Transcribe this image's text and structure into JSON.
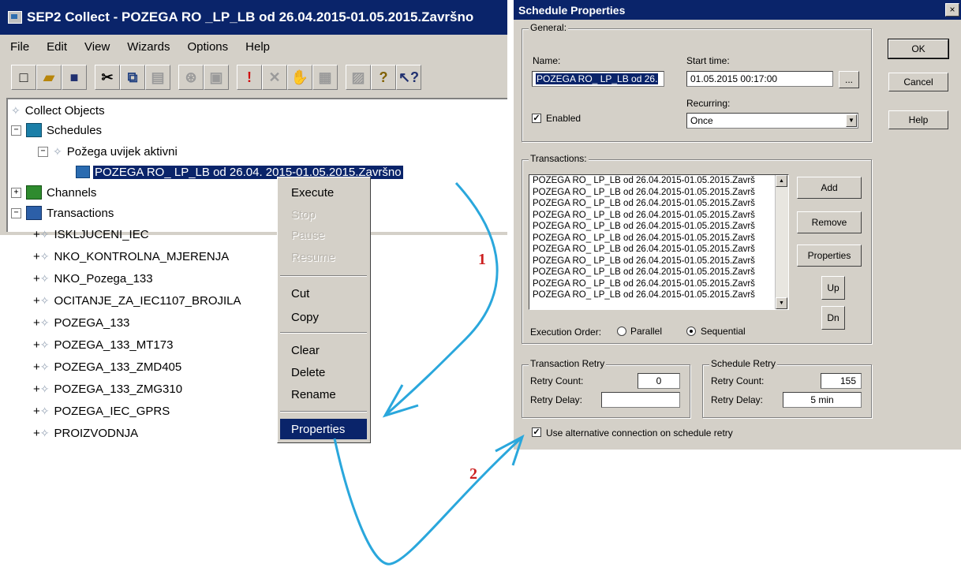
{
  "app": {
    "title": "SEP2 Collect - POZEGA RO _LP_LB od 26.04.2015-01.05.2015.Završno",
    "menu": [
      "File",
      "Edit",
      "View",
      "Wizards",
      "Options",
      "Help"
    ],
    "toolbar_icons": [
      "new-icon",
      "open-icon",
      "save-icon",
      "cut-icon",
      "copy-icon",
      "paste-icon",
      "connect-icon",
      "properties-icon",
      "exclamation-icon",
      "stop-icon",
      "hand-icon",
      "grid-icon",
      "print-icon",
      "help-icon",
      "context-help-icon"
    ],
    "tree": {
      "root": "Collect Objects",
      "schedules": "Schedules",
      "schedule_group": "Požega uvijek aktivni",
      "schedule_item": "POZEGA RO_ LP_LB od 26.04. 2015-01.05.2015.Završno",
      "channels": "Channels",
      "transactions": "Transactions",
      "transaction_items": [
        "ISKLJUCENI_IEC",
        "NKO_KONTROLNA_MJERENJA",
        "NKO_Pozega_133",
        "OCITANJE_ZA_IEC1107_BROJILA",
        "POZEGA_133",
        "POZEGA_133_MT173",
        "POZEGA_133_ZMD405",
        "POZEGA_133_ZMG310",
        "POZEGA_IEC_GPRS",
        "PROIZVODNJA"
      ]
    }
  },
  "context_menu": {
    "items": [
      {
        "label": "Execute",
        "enabled": true
      },
      {
        "label": "Stop",
        "enabled": false
      },
      {
        "label": "Pause",
        "enabled": false
      },
      {
        "label": "Resume",
        "enabled": false
      },
      {
        "label": "Cut",
        "enabled": true
      },
      {
        "label": "Copy",
        "enabled": true
      },
      {
        "label": "Clear",
        "enabled": true
      },
      {
        "label": "Delete",
        "enabled": true
      },
      {
        "label": "Rename",
        "enabled": true
      },
      {
        "label": "Properties",
        "enabled": true,
        "active": true
      }
    ]
  },
  "dialog": {
    "title": "Schedule Properties",
    "close": "×",
    "general": {
      "group_label": "General:",
      "name_label": "Name:",
      "name_value": "POZEGA RO_ LP_LB od 26.",
      "start_label": "Start time:",
      "start_value": "01.05.2015 00:17:00",
      "browse": "...",
      "enabled_label": "Enabled",
      "enabled_checked": true,
      "recurring_label": "Recurring:",
      "recurring_value": "Once"
    },
    "buttons": {
      "ok": "OK",
      "cancel": "Cancel",
      "help": "Help"
    },
    "transactions": {
      "group_label": "Transactions:",
      "rows": [
        "POZEGA RO_ LP_LB od 26.04.2015-01.05.2015.Završ",
        "POZEGA RO_ LP_LB od 26.04.2015-01.05.2015.Završ",
        "POZEGA RO_ LP_LB od 26.04.2015-01.05.2015.Završ",
        "POZEGA RO_ LP_LB od 26.04.2015-01.05.2015.Završ",
        "POZEGA RO_ LP_LB od 26.04.2015-01.05.2015.Završ",
        "POZEGA RO_ LP_LB od 26.04.2015-01.05.2015.Završ",
        "POZEGA RO_ LP_LB od 26.04.2015-01.05.2015.Završ",
        "POZEGA RO_ LP_LB od 26.04.2015-01.05.2015.Završ",
        "POZEGA RO_ LP_LB od 26.04.2015-01.05.2015.Završ",
        "POZEGA RO_ LP_LB od 26.04.2015-01.05.2015.Završ",
        "POZEGA RO_ LP_LB od 26.04.2015-01.05.2015.Završ"
      ],
      "add": "Add",
      "remove": "Remove",
      "properties": "Properties",
      "up": "Up",
      "dn": "Dn",
      "exec_order_label": "Execution Order:",
      "parallel": "Parallel",
      "sequential": "Sequential",
      "selected_order": "Sequential"
    },
    "transaction_retry": {
      "group_label": "Transaction Retry",
      "count_label": "Retry Count:",
      "count_value": "0",
      "delay_label": "Retry Delay:",
      "delay_value": ""
    },
    "schedule_retry": {
      "group_label": "Schedule Retry",
      "count_label": "Retry Count:",
      "count_value": "155",
      "delay_label": "Retry Delay:",
      "delay_value": "5 min"
    },
    "alt_connection_label": "Use alternative connection on schedule retry",
    "alt_connection_checked": true
  },
  "annotations": {
    "step1": "1",
    "step2": "2",
    "arrow_color": "#2aa7dc",
    "number_color": "#cc1f1f"
  }
}
